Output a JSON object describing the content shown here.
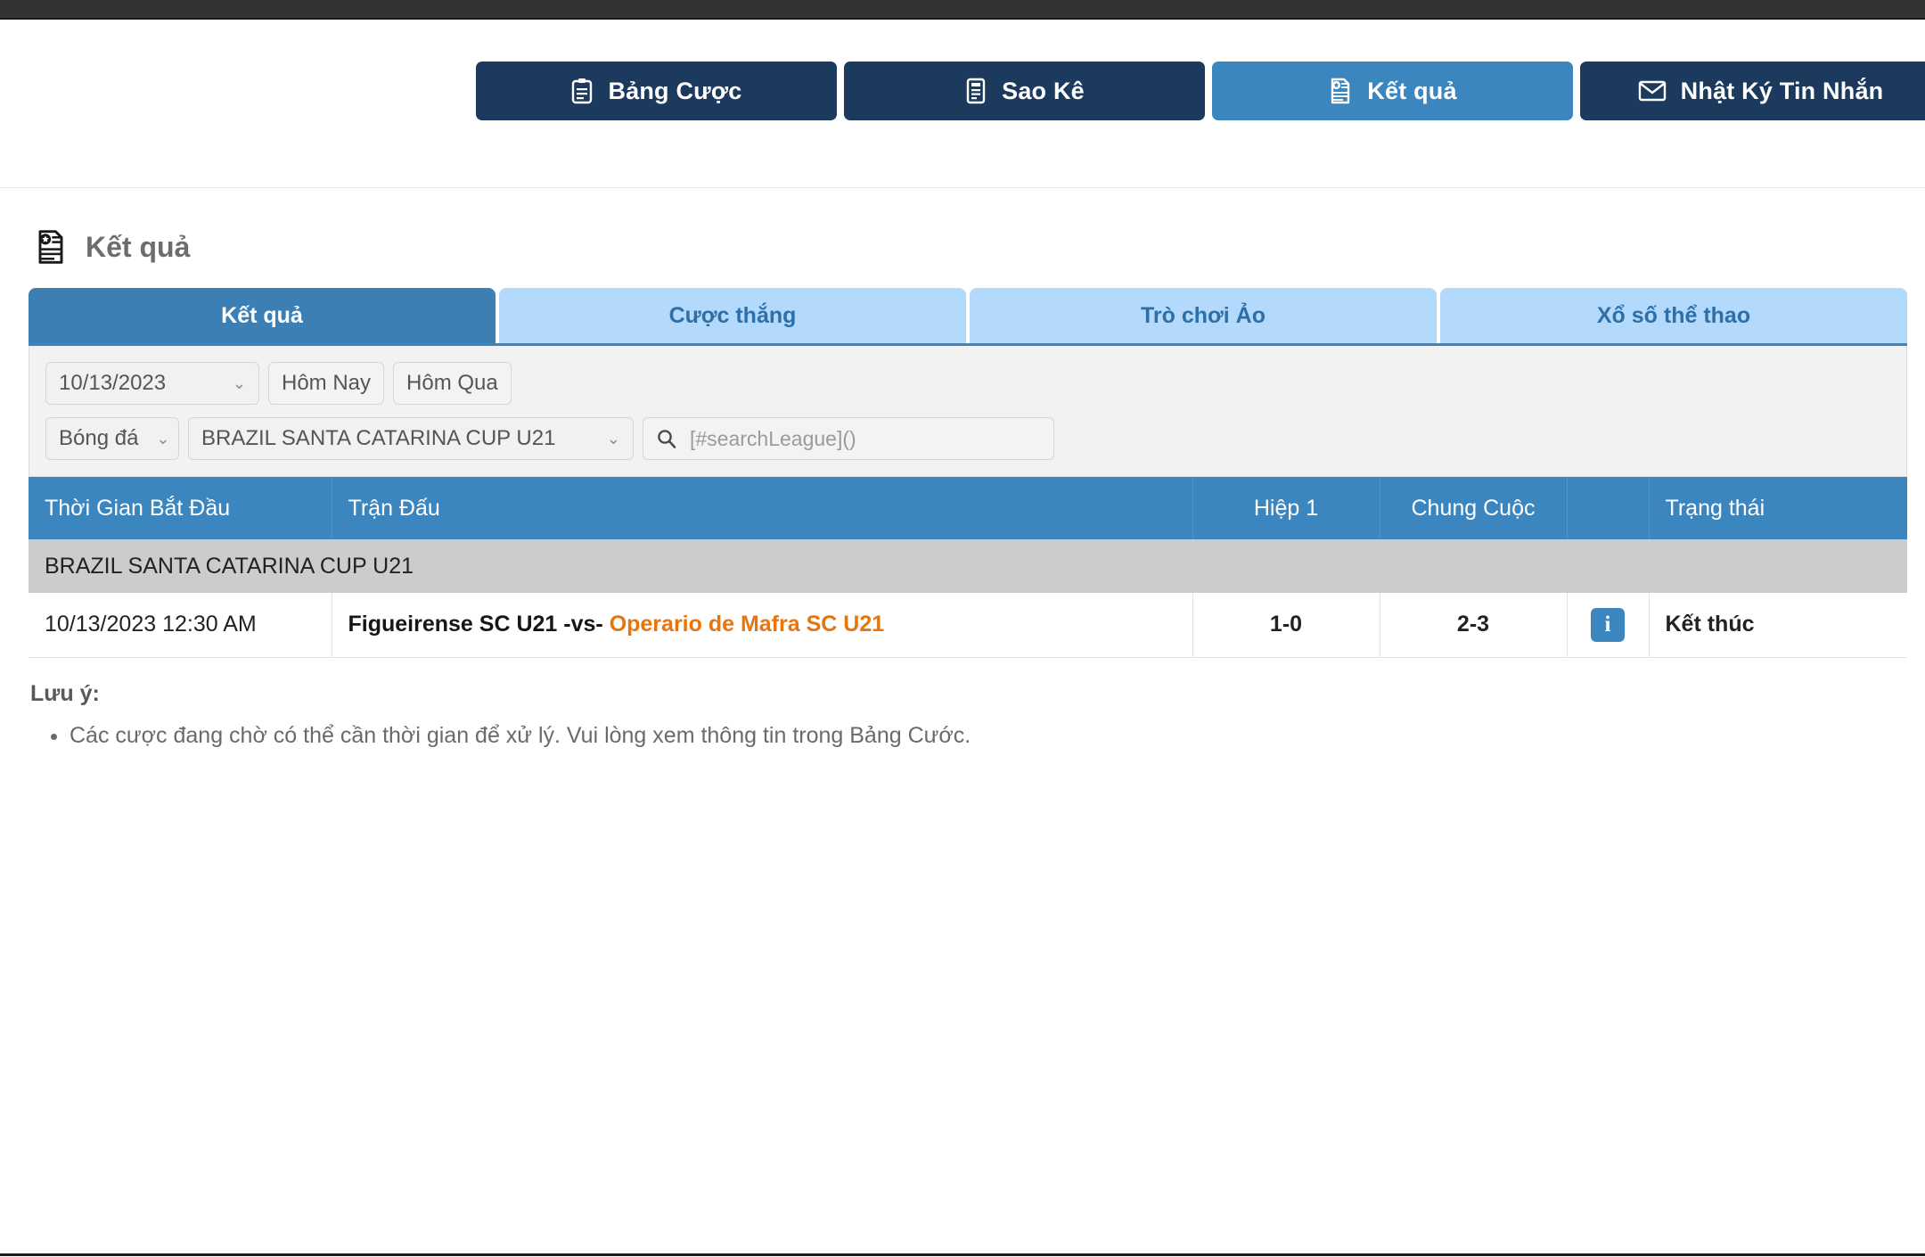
{
  "nav": {
    "buttons": [
      {
        "label": "Bảng Cược",
        "icon": "clipboard-icon",
        "active": false
      },
      {
        "label": "Sao Kê",
        "icon": "statement-icon",
        "active": false
      },
      {
        "label": "Kết quả",
        "icon": "results-icon",
        "active": true
      },
      {
        "label": "Nhật Ký Tin Nhắn",
        "icon": "envelope-icon",
        "active": false
      }
    ]
  },
  "page": {
    "title": "Kết quả",
    "title_icon": "results-icon"
  },
  "tabs": [
    {
      "label": "Kết quả",
      "active": true
    },
    {
      "label": "Cược thắng",
      "active": false
    },
    {
      "label": "Trò chơi Ảo",
      "active": false
    },
    {
      "label": "Xổ số thể thao",
      "active": false
    }
  ],
  "filters": {
    "date_value": "10/13/2023",
    "today_label": "Hôm Nay",
    "yesterday_label": "Hôm Qua",
    "sport_value": "Bóng đá",
    "league_value": "BRAZIL SANTA CATARINA CUP U21",
    "search_placeholder": "[#searchLeague]()",
    "search_value": "",
    "search_icon": "search-icon",
    "chevron": "⌄"
  },
  "table": {
    "headers": {
      "time": "Thời Gian Bắt Đầu",
      "match": "Trận Đấu",
      "half1": "Hiệp 1",
      "fulltime": "Chung Cuộc",
      "info": "",
      "status": "Trạng thái"
    },
    "league_group": "BRAZIL SANTA CATARINA CUP U21",
    "rows": [
      {
        "time": "10/13/2023 12:30 AM",
        "home": "Figueirense SC U21",
        "vs": "-vs-",
        "away": "Operario de Mafra SC U21",
        "half1": "1-0",
        "fulltime": "2-3",
        "info_icon": "info-icon",
        "status": "Kết thúc"
      }
    ]
  },
  "notes": {
    "title": "Lưu ý:",
    "items": [
      "Các cược đang chờ có thể cần thời gian để xử lý. Vui lòng xem thông tin trong Bảng Cước."
    ]
  },
  "colors": {
    "nav_dark": "#1c3a5e",
    "nav_active": "#3c86c0",
    "tab_active": "#3c7fb5",
    "tab_inactive": "#b3dafc",
    "table_header": "#3c86c0",
    "away_team": "#e8740c",
    "league_row": "#cccccc"
  }
}
